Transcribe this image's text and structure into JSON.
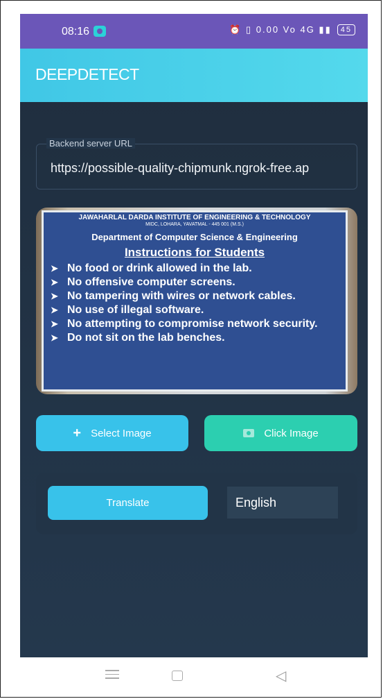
{
  "status_bar": {
    "time": "08:16",
    "icons": "⏰ ▯ 0.00 Vo 4G ▮▮",
    "battery": "45"
  },
  "app": {
    "title": "DEEPDETECT"
  },
  "url_field": {
    "label": "Backend server URL",
    "value": "https://possible-quality-chipmunk.ngrok-free.ap"
  },
  "image_preview": {
    "institute": "JAWAHARLAL DARDA INSTITUTE OF ENGINEERING & TECHNOLOGY",
    "address": "MIDC, LOHARA, YAVATMAL - 445 001 (M.S.)",
    "department": "Department of Computer Science & Engineering",
    "heading": "Instructions for Students",
    "instructions": [
      "No food or drink allowed in the lab.",
      "No offensive computer screens.",
      "No tampering with wires or network cables.",
      "No use of illegal software.",
      "No attempting to compromise network security.",
      "Do not sit on the lab benches."
    ]
  },
  "buttons": {
    "select_image": "Select Image",
    "click_image": "Click Image",
    "translate": "Translate"
  },
  "language": {
    "selected": "English"
  },
  "colors": {
    "status_bar": "#6b56b8",
    "header": "#40c7e6",
    "select_button": "#38c2ea",
    "click_button": "#2ccfb0",
    "background": "#1f2d3d"
  },
  "icons": {
    "select": "plus-icon",
    "click": "camera-icon",
    "nav_menu": "menu-icon",
    "nav_home": "home-icon",
    "nav_back": "back-icon"
  }
}
